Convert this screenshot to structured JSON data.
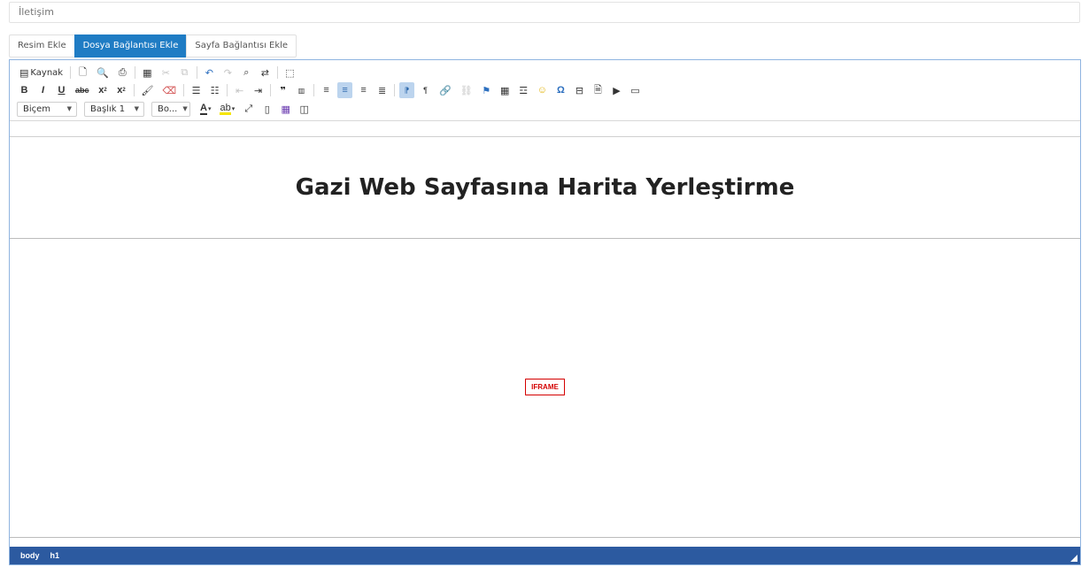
{
  "title_field": {
    "value": "İletişim"
  },
  "tabs": [
    {
      "label": "Resim Ekle",
      "active": false
    },
    {
      "label": "Dosya Bağlantısı Ekle",
      "active": true
    },
    {
      "label": "Sayfa Bağlantısı Ekle",
      "active": false
    }
  ],
  "toolbar": {
    "source_label": "Kaynak",
    "bold_label": "B",
    "italic_label": "I",
    "underline_label": "U",
    "strike_label": "abc",
    "subscript_label": "x",
    "superscript_label": "x",
    "format_combo": "Biçem",
    "heading_combo": "Başlık 1",
    "size_combo": "Bo...",
    "font_color_label": "A"
  },
  "content": {
    "heading": "Gazi Web Sayfasına Harita Yerleştirme",
    "iframe_placeholder": "IFRAME"
  },
  "statusbar": {
    "path": [
      "body",
      "h1"
    ]
  },
  "colors": {
    "accent": "#1f7cc4",
    "statusbar": "#2c5aa0",
    "iframe_border": "#d40000"
  }
}
